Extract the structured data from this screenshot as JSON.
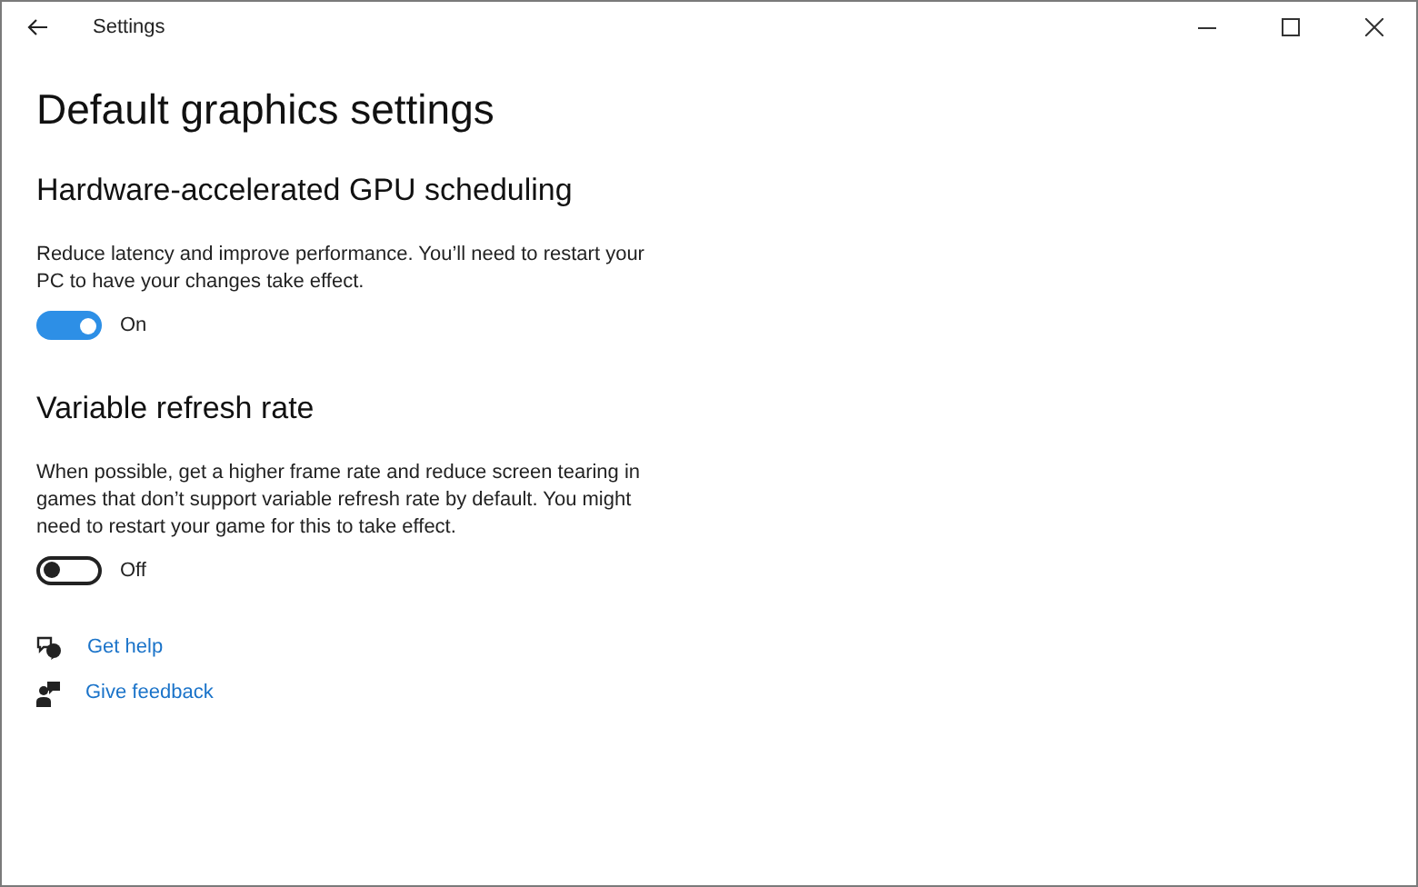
{
  "window": {
    "title": "Settings"
  },
  "page_title": "Default graphics settings",
  "sections": [
    {
      "heading": "Hardware-accelerated GPU scheduling",
      "description": "Reduce latency and improve performance. You’ll need to restart your PC to have your changes take effect.",
      "toggle": {
        "on": true,
        "label": "On"
      }
    },
    {
      "heading": "Variable refresh rate",
      "description": "When possible, get a higher frame rate and reduce screen tearing in games that don’t support variable refresh rate by default. You might need to restart your game for this to take effect.",
      "toggle": {
        "on": false,
        "label": "Off"
      }
    }
  ],
  "links": [
    {
      "kind": "help",
      "label": "Get help"
    },
    {
      "kind": "feedback",
      "label": "Give feedback"
    }
  ]
}
